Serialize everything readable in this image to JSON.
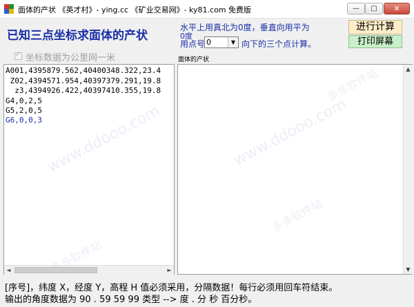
{
  "window": {
    "title": "面体的产状   《英才村》- ying.cc   《矿业交易网》- ky81.com   免费版",
    "minimize_glyph": "—",
    "maximize_glyph": "□",
    "close_glyph": "✕"
  },
  "header": {
    "heading": "已知三点坐标求面体的产状",
    "note_line1": "水平上用真北为0度，垂直向用平为",
    "note_line2": "0度",
    "point_label": "用点号",
    "point_value": "0",
    "point_arrow": "▼",
    "point_after": "向下的三个点计算。",
    "calc_button": "进行计算",
    "print_button": "打印屏幕",
    "checkbox_mark": "✓",
    "checkbox_label": "坐标数据为公里网一米",
    "result_caption": "面体的产状"
  },
  "input_lines": [
    "A001,4395879.562,40400348.322,23.4",
    " Z02,4394571.954,40397379.291,19.8",
    "  z3,4394926.422,40397410.355,19.8",
    "G4,0,2,5",
    "G5,2,0,5",
    "G6,0,0,3"
  ],
  "scroll": {
    "left_arrow": "◄",
    "right_arrow": "►",
    "up_arrow": "▲",
    "down_arrow": "▼"
  },
  "footer": {
    "line1": "[序号]，纬度 X，经度 Y，高程 H 值必须采用，分隔数据！每行必须用回车符结束。",
    "line2": "输出的角度数据为 90 . 59 59 99 类型 --> 度 . 分 秒 百分秒。"
  },
  "watermark": {
    "text1": "www.ddooo.com",
    "text2": "多多软件站"
  },
  "colors": {
    "accent_blue": "#1a2ea8",
    "calc_bg": "#fcecc8",
    "print_bg": "#c8f0c8"
  }
}
